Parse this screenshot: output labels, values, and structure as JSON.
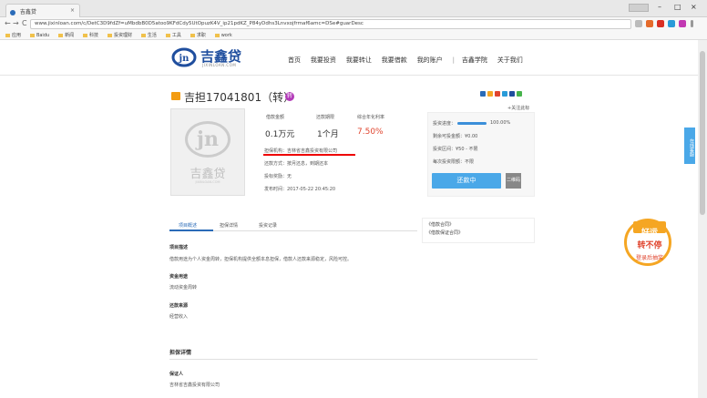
{
  "browser": {
    "tab_title": "吉鑫贷",
    "tab_close": "×",
    "address": "www.jixinloan.com/c/DetC3D9fdZf=uMbdbB0D5atoo9KFdCdy5UtOpuzK4V_ip21pdKZ_P84yDdhs3Lnvxojfrmaf6amc=DSe#guarDesc",
    "nav_back": "←",
    "nav_forward": "→",
    "nav_reload": "C",
    "window_min": "–",
    "window_max": "□",
    "window_close": "×",
    "window_flag": "",
    "bookmarks": [
      "应用",
      "Baidu",
      "新闻",
      "科技",
      "投资理财",
      "生活",
      "工具",
      "求职",
      "work"
    ]
  },
  "site": {
    "logo_cn": "吉鑫贷",
    "logo_en": "JIXINLOAN.COM",
    "logo_mark": "jn",
    "nav": [
      "首页",
      "我要投资",
      "我要转让",
      "我要借款",
      "我的账户",
      "吉鑫学院",
      "关于我们"
    ],
    "nav_sep": "|"
  },
  "loan": {
    "title": "吉担17041801（转）",
    "badge": "转",
    "follow": "+关注此标",
    "stats": {
      "amount_label": "借款金额",
      "amount_value": "0.1万元",
      "term_label": "还款期限",
      "term_value": "1个月",
      "rate_label": "综合年化利率",
      "rate_value": "7.50%"
    },
    "guarantor": "担保机构：吉林省吉鑫投资有限公司",
    "repay_method": "还款方式：按月还息，到期还本",
    "bid_reward": "投标奖励：无",
    "publish_time": "发布时间：2017-05-22 20:45:20"
  },
  "invest": {
    "progress_label": "投资进度：",
    "progress_value": "100.00%",
    "progress_fraction": 1.0,
    "remain": "剩余可投金额：¥0.00",
    "limit": "投资区间：¥50 - 不限",
    "daily": "每次投资限额：不限",
    "button": "还款中",
    "qr": "二维码"
  },
  "tabs": [
    "项目概述",
    "担保详情",
    "投资记录"
  ],
  "contracts": [
    "《借款合同》",
    "《借款保证合同》"
  ],
  "sections": [
    {
      "head": "项目描述",
      "text": "借款用途为个人资金周转，担保机构提供全额本息担保，借款人还款来源稳定，风险可控。"
    },
    {
      "head": "资金用途",
      "text": "流动资金周转"
    },
    {
      "head": "还款来源",
      "text": "经营收入"
    }
  ],
  "guarantee": {
    "title": "担保详情",
    "head": "保证人",
    "text": "吉林省吉鑫投资有限公司"
  },
  "side": {
    "float_tab": "在线客服",
    "promo_a": "好运",
    "promo_b": "转不停",
    "promo_c": "登录后抽奖"
  },
  "colors": {
    "brand": "#1f4e9e",
    "accent": "#4aa8e8",
    "rate": "#e0452f",
    "underline": "#ee0000"
  }
}
